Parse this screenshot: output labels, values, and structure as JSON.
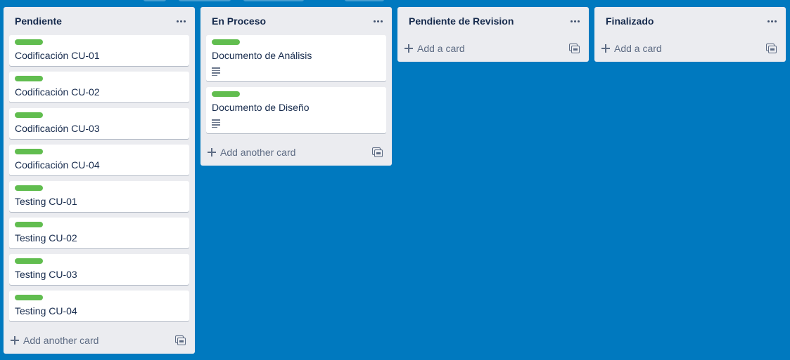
{
  "board": {
    "lists": [
      {
        "title": "Pendiente",
        "cards": [
          {
            "title": "Codificación CU-01",
            "label_color": "#61bd4f",
            "has_description": false
          },
          {
            "title": "Codificación CU-02",
            "label_color": "#61bd4f",
            "has_description": false
          },
          {
            "title": "Codificación CU-03",
            "label_color": "#61bd4f",
            "has_description": false
          },
          {
            "title": "Codificación CU-04",
            "label_color": "#61bd4f",
            "has_description": false
          },
          {
            "title": "Testing CU-01",
            "label_color": "#61bd4f",
            "has_description": false
          },
          {
            "title": "Testing CU-02",
            "label_color": "#61bd4f",
            "has_description": false
          },
          {
            "title": "Testing CU-03",
            "label_color": "#61bd4f",
            "has_description": false
          },
          {
            "title": "Testing CU-04",
            "label_color": "#61bd4f",
            "has_description": false
          }
        ],
        "add_label": "Add another card"
      },
      {
        "title": "En Proceso",
        "cards": [
          {
            "title": "Documento de Análisis",
            "label_color": "#61bd4f",
            "has_description": true
          },
          {
            "title": "Documento de Diseño",
            "label_color": "#61bd4f",
            "has_description": true
          }
        ],
        "add_label": "Add another card"
      },
      {
        "title": "Pendiente de Revision",
        "cards": [],
        "add_label": "Add a card"
      },
      {
        "title": "Finalizado",
        "cards": [],
        "add_label": "Add a card"
      }
    ]
  },
  "icons": {
    "list_menu": "ellipsis-icon",
    "add": "plus-icon",
    "template": "card-template-icon",
    "description": "description-icon"
  },
  "colors": {
    "board_background": "#0079bf",
    "list_background": "#ebecf0",
    "label_green": "#61bd4f"
  }
}
